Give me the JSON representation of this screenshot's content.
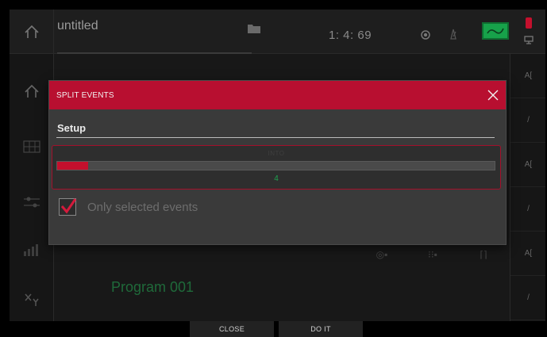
{
  "header": {
    "title": "untitled",
    "counter": "1:  4:  69"
  },
  "modal": {
    "title": "SPLIT EVENTS",
    "tab": "Setup",
    "into": {
      "label": "INTO",
      "value": "4",
      "level_fraction": 0.07
    },
    "checkbox": {
      "label": "Only selected events",
      "checked": true
    }
  },
  "background": {
    "program_name": "Program 001"
  },
  "footer": {
    "close_label": "CLOSE",
    "do_it_label": "DO IT"
  },
  "right_column": {
    "items": [
      "A[",
      "/",
      "A[",
      "/",
      "A[",
      "/"
    ]
  },
  "colors": {
    "accent": "#c4102d",
    "header_red": "#b80f30",
    "value_green": "#1fa24f",
    "program_green": "#1f6a3a"
  },
  "icons": {
    "home": "home-icon",
    "close": "close-icon",
    "folder": "folder-icon",
    "check": "check-icon"
  }
}
